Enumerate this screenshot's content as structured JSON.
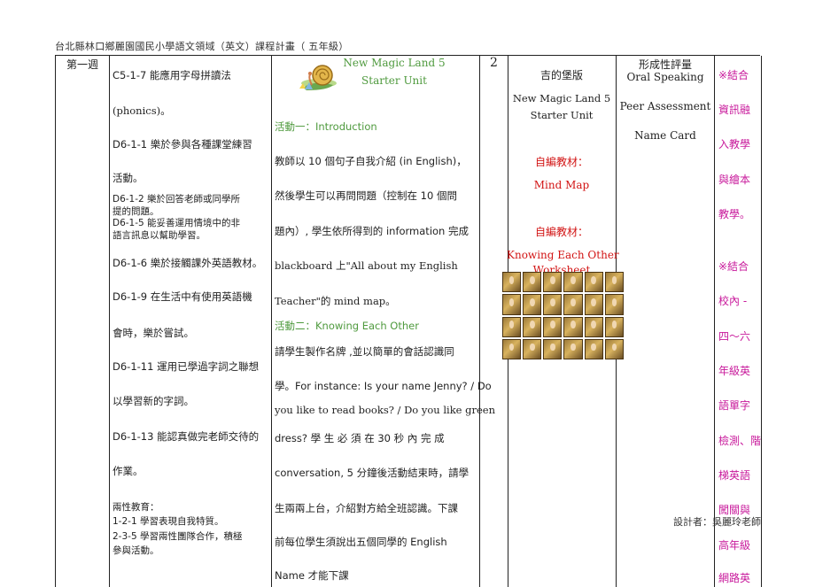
{
  "header": {
    "title": "台北縣林口鄉麗園國民小學語文領域（英文）課程計畫（  五年級）"
  },
  "week": "第一週",
  "goals": [
    "C5-1-7 能應用字母拼讀法",
    "(phonics)。",
    "D6-1-1 樂於參與各種課堂練習",
    "活動。",
    "D6-1-2 樂於回答老師或同學所",
    "提的問題。",
    "D6-1-5 能妥善運用情境中的非",
    "語言訊息以幫助學習。",
    "D6-1-6 樂於接觸課外英語教材。",
    "D6-1-9 在生活中有使用英語機",
    "會時，樂於嘗試。",
    "D6-1-11 運用已學過字詞之聯想",
    "以學習新的字詞。",
    "D6-1-13 能認真做完老師交待的",
    "作業。",
    "兩性教育：",
    "1-2-1 學習表現自我特質。",
    "2-3-5 學習兩性團隊合作，積極",
    "參與活動。"
  ],
  "activity": {
    "book_title": "New Magic Land 5",
    "unit": "Starter Unit",
    "act1_title": "活動一：Introduction",
    "act1_lines": [
      "教師以 10 個句子自我介紹  (in English)，",
      "然後學生可以再問問題（控制在 10 個問",
      "題內）, 學生依所得到的 information 完成",
      "blackboard 上\"All about my English",
      "Teacher\"的 mind map。"
    ],
    "act2_title": "活動二：Knowing Each Other",
    "act2_lines": [
      "請學生製作名牌 ,並以簡單的會話認識同",
      "學。For instance: Is your name Jenny? / Do",
      "you like to read books? / Do you like green",
      "dress?  學  生  必  須  在  30  秒  內  完  成",
      "conversation, 5 分鐘後活動結束時，請學",
      "生兩兩上台，介紹對方給全班認識。下課",
      "前每位學生須說出五個同學的 English",
      "Name 才能下課"
    ]
  },
  "hours": "2",
  "resources": {
    "publisher": "吉的堡版",
    "book": "New Magic Land 5",
    "unit": "Starter Unit",
    "self_made_label_1": "自編教材：",
    "material_1": "Mind Map",
    "self_made_label_2": "自編教材：",
    "material_2": "Knowing Each Other",
    "material_2b": "Worksheet"
  },
  "assessment": {
    "title": "形成性評量",
    "items": [
      "Oral Speaking",
      "Peer Assessment",
      "Name Card"
    ]
  },
  "notes": [
    "※結合",
    "資訊融",
    "入教學",
    "與繪本",
    "教學。",
    "※結合",
    "校內 -",
    "四～六",
    "年級英",
    "語單字",
    "檢測、階",
    "梯英語",
    "闖關與",
    "高年級",
    "網路英"
  ],
  "designer": "設計者：吳麗玲老師",
  "colors": {
    "green": "#4f9a3e",
    "red": "#d21414",
    "magenta": "#c8199b"
  }
}
